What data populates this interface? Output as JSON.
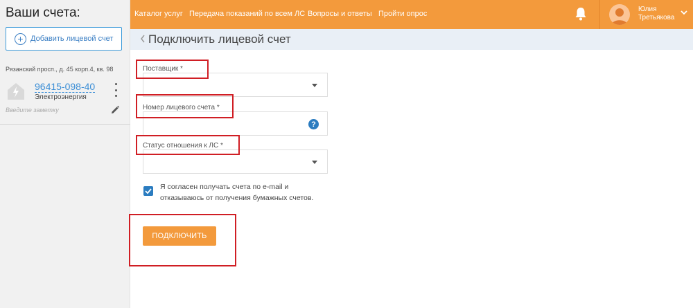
{
  "sidebar": {
    "title": "Ваши счета:",
    "add_button_label": "Добавить лицевой счет",
    "address": "Рязанский просп., д. 45 корп.4, кв. 98",
    "account": {
      "number": "96415-098-40",
      "provider": "Электроэнергия",
      "note_placeholder": "Введите заметку"
    }
  },
  "topbar": {
    "nav": [
      "Каталог услуг",
      "Передача показаний по всем ЛС",
      "Вопросы и ответы",
      "Пройти опрос"
    ],
    "user": {
      "first_name": "Юлия",
      "last_name": "Третьякова"
    },
    "accent_color": "#f39a3c"
  },
  "page": {
    "title": "Подключить лицевой счет",
    "fields": {
      "supplier_label": "Поставщик *",
      "account_number_label": "Номер лицевого счета *",
      "relation_status_label": "Статус отношения к ЛС *"
    },
    "help_glyph": "?",
    "consent_text": "Я согласен получать счета по e-mail и отказываюсь от получения бумажных счетов.",
    "consent_checked": true,
    "submit_label": "ПОДКЛЮЧИТЬ"
  }
}
